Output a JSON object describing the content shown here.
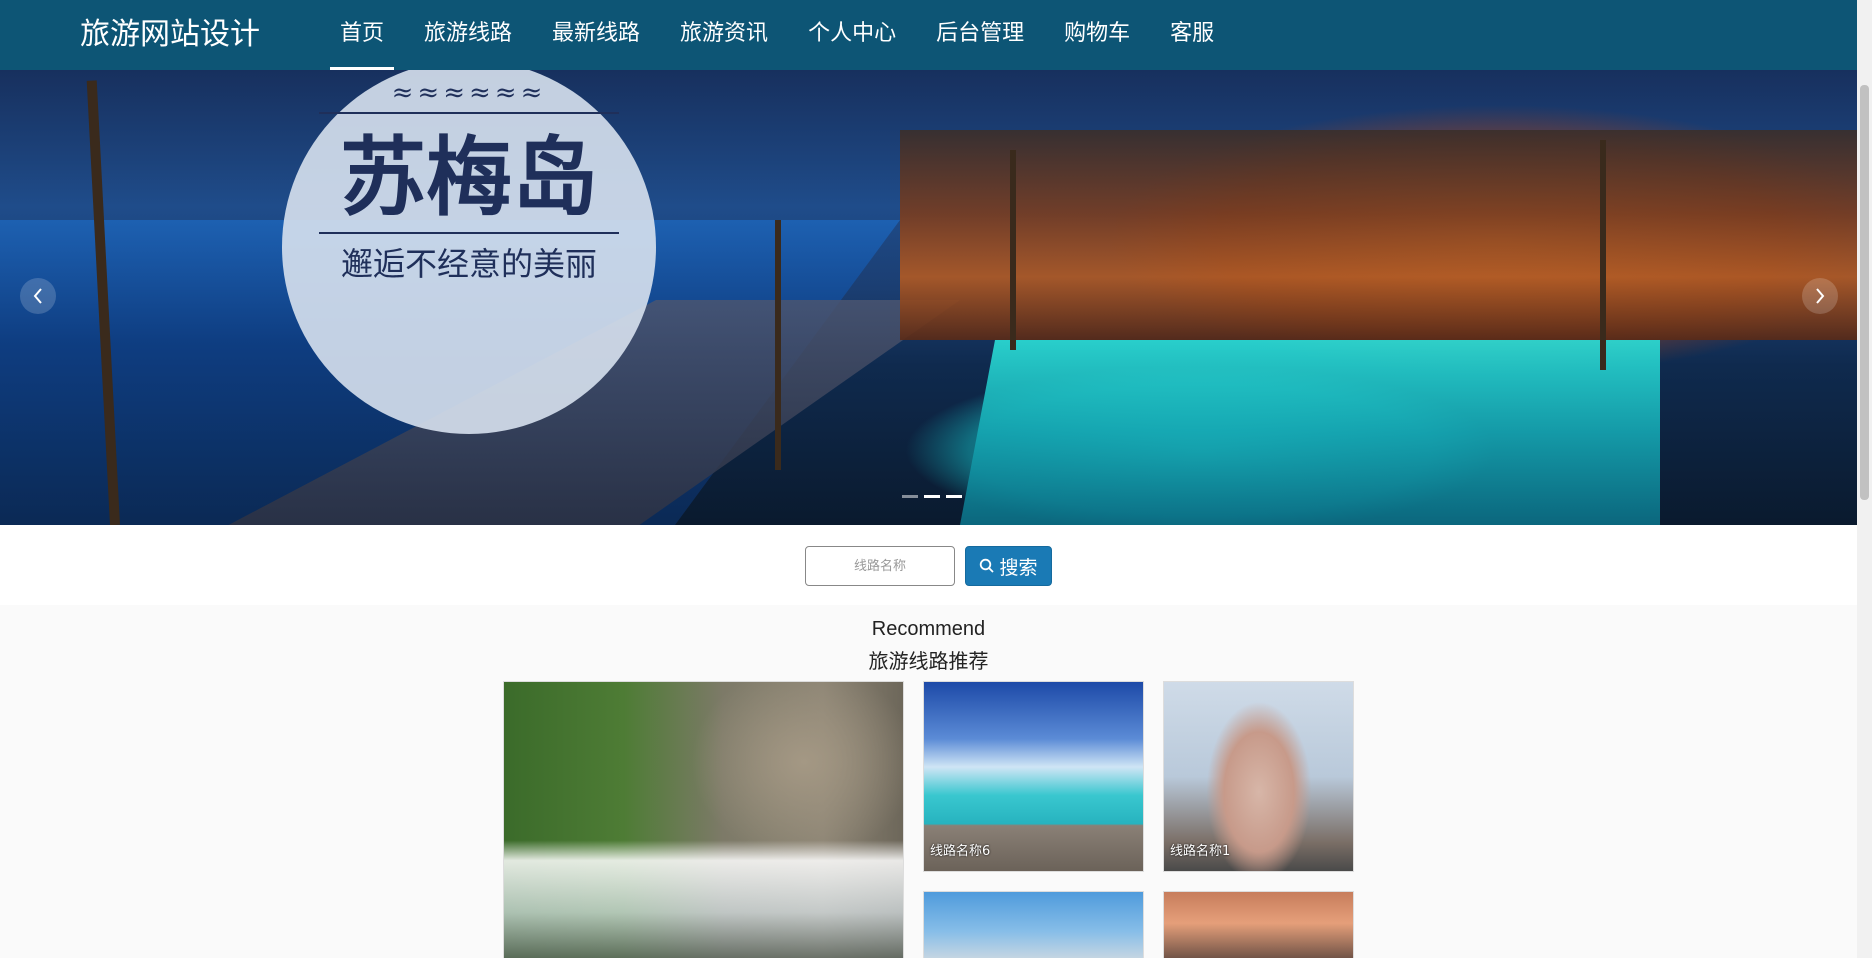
{
  "brand": "旅游网站设计",
  "nav": {
    "items": [
      {
        "label": "首页",
        "active": true
      },
      {
        "label": "旅游线路"
      },
      {
        "label": "最新线路"
      },
      {
        "label": "旅游资讯"
      },
      {
        "label": "个人中心"
      },
      {
        "label": "后台管理"
      },
      {
        "label": "购物车"
      },
      {
        "label": "客服"
      }
    ]
  },
  "carousel": {
    "badge_ornament": "≈≈≈≈≈≈",
    "badge_title": "苏梅岛",
    "badge_subtitle": "邂逅不经意的美丽",
    "prev_icon": "chevron-left-icon",
    "next_icon": "chevron-right-icon",
    "indicator_count": 3,
    "active_index": 1
  },
  "search": {
    "placeholder": "线路名称",
    "button_label": "搜索",
    "button_icon": "search-icon",
    "button_color": "#1a7ab5"
  },
  "recommend": {
    "heading_en": "Recommend",
    "heading_cn": "旅游线路推荐",
    "cards": [
      {
        "label": ""
      },
      {
        "label": "线路名称6"
      },
      {
        "label": "线路名称1"
      },
      {
        "label": ""
      },
      {
        "label": ""
      }
    ]
  },
  "colors": {
    "navbar": "#0d5575",
    "accent": "#1a7ab5"
  }
}
